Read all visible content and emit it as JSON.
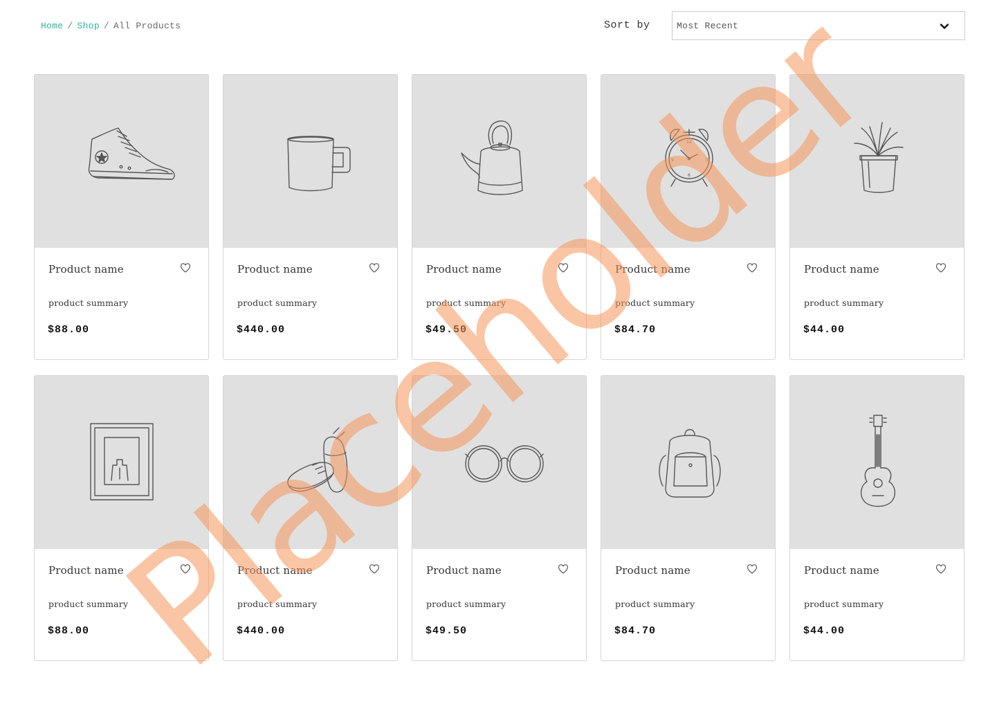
{
  "breadcrumb": {
    "home": "Home",
    "shop": "Shop",
    "current": "All Products",
    "separator": "/"
  },
  "sort": {
    "label": "Sort by",
    "selected": "Most Recent",
    "icon": "chevron-down-icon"
  },
  "products": [
    {
      "name": "Product name",
      "summary": "product summary",
      "price": "$88.00",
      "image": "sneaker-icon"
    },
    {
      "name": "Product name",
      "summary": "product summary",
      "price": "$440.00",
      "image": "mug-icon"
    },
    {
      "name": "Product name",
      "summary": "product summary",
      "price": "$49.50",
      "image": "kettle-icon"
    },
    {
      "name": "Product name",
      "summary": "product summary",
      "price": "$84.70",
      "image": "alarm-clock-icon"
    },
    {
      "name": "Product name",
      "summary": "product summary",
      "price": "$44.00",
      "image": "potted-plant-icon"
    },
    {
      "name": "Product name",
      "summary": "product summary",
      "price": "$88.00",
      "image": "picture-frame-icon"
    },
    {
      "name": "Product name",
      "summary": "product summary",
      "price": "$440.00",
      "image": "shoes-icon"
    },
    {
      "name": "Product name",
      "summary": "product summary",
      "price": "$49.50",
      "image": "sunglasses-icon"
    },
    {
      "name": "Product name",
      "summary": "product summary",
      "price": "$84.70",
      "image": "backpack-icon"
    },
    {
      "name": "Product name",
      "summary": "product summary",
      "price": "$44.00",
      "image": "guitar-icon"
    }
  ],
  "watermark": "Placeholder",
  "colors": {
    "accent": "#2bb59a",
    "image_bg": "#e0e0e0",
    "watermark": "#f5965a",
    "border": "#d5d5d5"
  }
}
